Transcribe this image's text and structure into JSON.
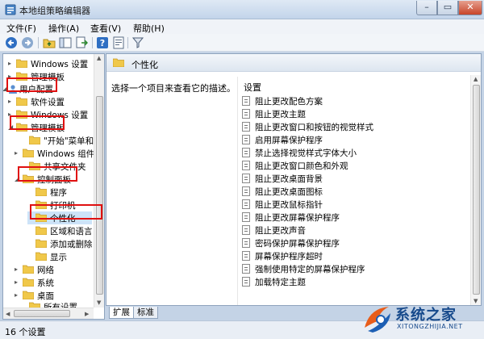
{
  "window": {
    "title": "本地组策略编辑器",
    "min_label": "–",
    "max_label": "▭",
    "close_label": "✕"
  },
  "menu": [
    "文件(F)",
    "操作(A)",
    "查看(V)",
    "帮助(H)"
  ],
  "tree": [
    {
      "label": "Windows 设置",
      "arrow": "▸"
    },
    {
      "label": "管理模板",
      "arrow": "▸"
    },
    {
      "label": "用户配置",
      "arrow": "◢"
    },
    {
      "label": "软件设置",
      "arrow": "▸"
    },
    {
      "label": "Windows 设置",
      "arrow": "▸"
    },
    {
      "label": "管理模板",
      "arrow": "◢"
    },
    {
      "label": "\"开始\"菜单和",
      "arrow": ""
    },
    {
      "label": "Windows 组件",
      "arrow": "▸"
    },
    {
      "label": "共享文件夹",
      "arrow": ""
    },
    {
      "label": "控制面板",
      "arrow": "◢"
    },
    {
      "label": "程序",
      "arrow": ""
    },
    {
      "label": "打印机",
      "arrow": ""
    },
    {
      "label": "个性化",
      "arrow": ""
    },
    {
      "label": "区域和语言",
      "arrow": ""
    },
    {
      "label": "添加或删除",
      "arrow": ""
    },
    {
      "label": "显示",
      "arrow": ""
    },
    {
      "label": "网络",
      "arrow": "▸"
    },
    {
      "label": "系统",
      "arrow": "▸"
    },
    {
      "label": "桌面",
      "arrow": "▸"
    },
    {
      "label": "所有设置",
      "arrow": ""
    }
  ],
  "right_pane": {
    "header": "个性化",
    "description": "选择一个项目来查看它的描述。",
    "settings_header": "设置",
    "settings": [
      "阻止更改配色方案",
      "阻止更改主题",
      "阻止更改窗口和按钮的视觉样式",
      "启用屏幕保护程序",
      "禁止选择视觉样式字体大小",
      "阻止更改窗口颜色和外观",
      "阻止更改桌面背景",
      "阻止更改桌面图标",
      "阻止更改鼠标指针",
      "阻止更改屏幕保护程序",
      "阻止更改声音",
      "密码保护屏幕保护程序",
      "屏幕保护程序超时",
      "强制使用特定的屏幕保护程序",
      "加载特定主题"
    ]
  },
  "tabs": [
    "扩展",
    "标准"
  ],
  "status": "16 个设置",
  "watermark": {
    "name": "系统之家",
    "url": "XITONGZHIJIA.NET"
  },
  "colors": {
    "highlight_box": "#e01010",
    "selected_row": "#cde3f8",
    "folder": "#f0c84a"
  }
}
